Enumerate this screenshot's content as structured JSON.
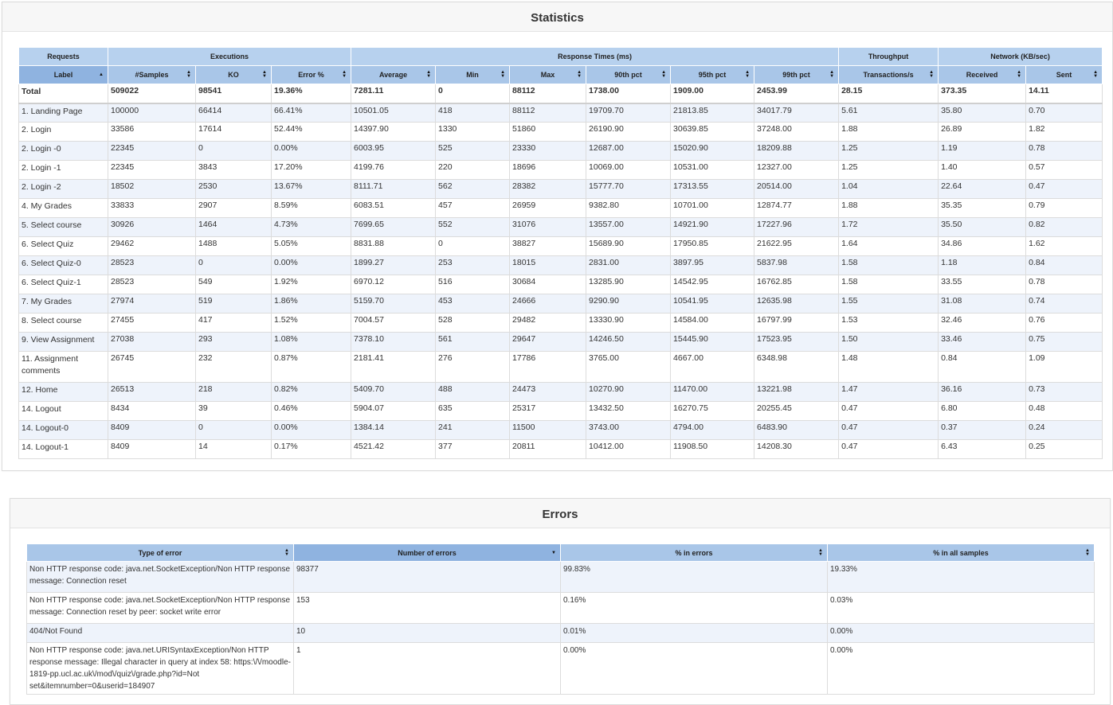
{
  "statistics": {
    "title": "Statistics",
    "group_headers": [
      "Requests",
      "Executions",
      "Response Times (ms)",
      "Throughput",
      "Network (KB/sec)"
    ],
    "columns": [
      "Label",
      "#Samples",
      "KO",
      "Error %",
      "Average",
      "Min",
      "Max",
      "90th pct",
      "95th pct",
      "99th pct",
      "Transactions/s",
      "Received",
      "Sent"
    ],
    "total": [
      "Total",
      "509022",
      "98541",
      "19.36%",
      "7281.11",
      "0",
      "88112",
      "1738.00",
      "1909.00",
      "2453.99",
      "28.15",
      "373.35",
      "14.11"
    ],
    "rows": [
      [
        "1. Landing Page",
        "100000",
        "66414",
        "66.41%",
        "10501.05",
        "418",
        "88112",
        "19709.70",
        "21813.85",
        "34017.79",
        "5.61",
        "35.80",
        "0.70"
      ],
      [
        "2. Login",
        "33586",
        "17614",
        "52.44%",
        "14397.90",
        "1330",
        "51860",
        "26190.90",
        "30639.85",
        "37248.00",
        "1.88",
        "26.89",
        "1.82"
      ],
      [
        "2. Login -0",
        "22345",
        "0",
        "0.00%",
        "6003.95",
        "525",
        "23330",
        "12687.00",
        "15020.90",
        "18209.88",
        "1.25",
        "1.19",
        "0.78"
      ],
      [
        "2. Login -1",
        "22345",
        "3843",
        "17.20%",
        "4199.76",
        "220",
        "18696",
        "10069.00",
        "10531.00",
        "12327.00",
        "1.25",
        "1.40",
        "0.57"
      ],
      [
        "2. Login -2",
        "18502",
        "2530",
        "13.67%",
        "8111.71",
        "562",
        "28382",
        "15777.70",
        "17313.55",
        "20514.00",
        "1.04",
        "22.64",
        "0.47"
      ],
      [
        "4. My Grades",
        "33833",
        "2907",
        "8.59%",
        "6083.51",
        "457",
        "26959",
        "9382.80",
        "10701.00",
        "12874.77",
        "1.88",
        "35.35",
        "0.79"
      ],
      [
        "5. Select course",
        "30926",
        "1464",
        "4.73%",
        "7699.65",
        "552",
        "31076",
        "13557.00",
        "14921.90",
        "17227.96",
        "1.72",
        "35.50",
        "0.82"
      ],
      [
        "6. Select Quiz",
        "29462",
        "1488",
        "5.05%",
        "8831.88",
        "0",
        "38827",
        "15689.90",
        "17950.85",
        "21622.95",
        "1.64",
        "34.86",
        "1.62"
      ],
      [
        "6. Select Quiz-0",
        "28523",
        "0",
        "0.00%",
        "1899.27",
        "253",
        "18015",
        "2831.00",
        "3897.95",
        "5837.98",
        "1.58",
        "1.18",
        "0.84"
      ],
      [
        "6. Select Quiz-1",
        "28523",
        "549",
        "1.92%",
        "6970.12",
        "516",
        "30684",
        "13285.90",
        "14542.95",
        "16762.85",
        "1.58",
        "33.55",
        "0.78"
      ],
      [
        "7. My Grades",
        "27974",
        "519",
        "1.86%",
        "5159.70",
        "453",
        "24666",
        "9290.90",
        "10541.95",
        "12635.98",
        "1.55",
        "31.08",
        "0.74"
      ],
      [
        "8. Select course",
        "27455",
        "417",
        "1.52%",
        "7004.57",
        "528",
        "29482",
        "13330.90",
        "14584.00",
        "16797.99",
        "1.53",
        "32.46",
        "0.76"
      ],
      [
        "9. View Assignment",
        "27038",
        "293",
        "1.08%",
        "7378.10",
        "561",
        "29647",
        "14246.50",
        "15445.90",
        "17523.95",
        "1.50",
        "33.46",
        "0.75"
      ],
      [
        "11. Assignment comments",
        "26745",
        "232",
        "0.87%",
        "2181.41",
        "276",
        "17786",
        "3765.00",
        "4667.00",
        "6348.98",
        "1.48",
        "0.84",
        "1.09"
      ],
      [
        "12. Home",
        "26513",
        "218",
        "0.82%",
        "5409.70",
        "488",
        "24473",
        "10270.90",
        "11470.00",
        "13221.98",
        "1.47",
        "36.16",
        "0.73"
      ],
      [
        "14. Logout",
        "8434",
        "39",
        "0.46%",
        "5904.07",
        "635",
        "25317",
        "13432.50",
        "16270.75",
        "20255.45",
        "0.47",
        "6.80",
        "0.48"
      ],
      [
        "14. Logout-0",
        "8409",
        "0",
        "0.00%",
        "1384.14",
        "241",
        "11500",
        "3743.00",
        "4794.00",
        "6483.90",
        "0.47",
        "0.37",
        "0.24"
      ],
      [
        "14. Logout-1",
        "8409",
        "14",
        "0.17%",
        "4521.42",
        "377",
        "20811",
        "10412.00",
        "11908.50",
        "14208.30",
        "0.47",
        "6.43",
        "0.25"
      ]
    ]
  },
  "errors": {
    "title": "Errors",
    "columns": [
      "Type of error",
      "Number of errors",
      "% in errors",
      "% in all samples"
    ],
    "rows": [
      [
        "Non HTTP response code: java.net.SocketException/Non HTTP response message: Connection reset",
        "98377",
        "99.83%",
        "19.33%"
      ],
      [
        "Non HTTP response code: java.net.SocketException/Non HTTP response message: Connection reset by peer: socket write error",
        "153",
        "0.16%",
        "0.03%"
      ],
      [
        "404/Not Found",
        "10",
        "0.01%",
        "0.00%"
      ],
      [
        "Non HTTP response code: java.net.URISyntaxException/Non HTTP response message: Illegal character in query at index 58: https:\\/\\/moodle-1819-pp.ucl.ac.uk\\/mod\\/quiz\\/grade.php?id=Not set&itemnumber=0&userid=184907",
        "1",
        "0.00%",
        "0.00%"
      ]
    ]
  },
  "icons": {
    "sort_both": "sort-both-icon",
    "sort_asc": "sort-ascending-icon",
    "sort_desc": "sort-descending-icon"
  }
}
